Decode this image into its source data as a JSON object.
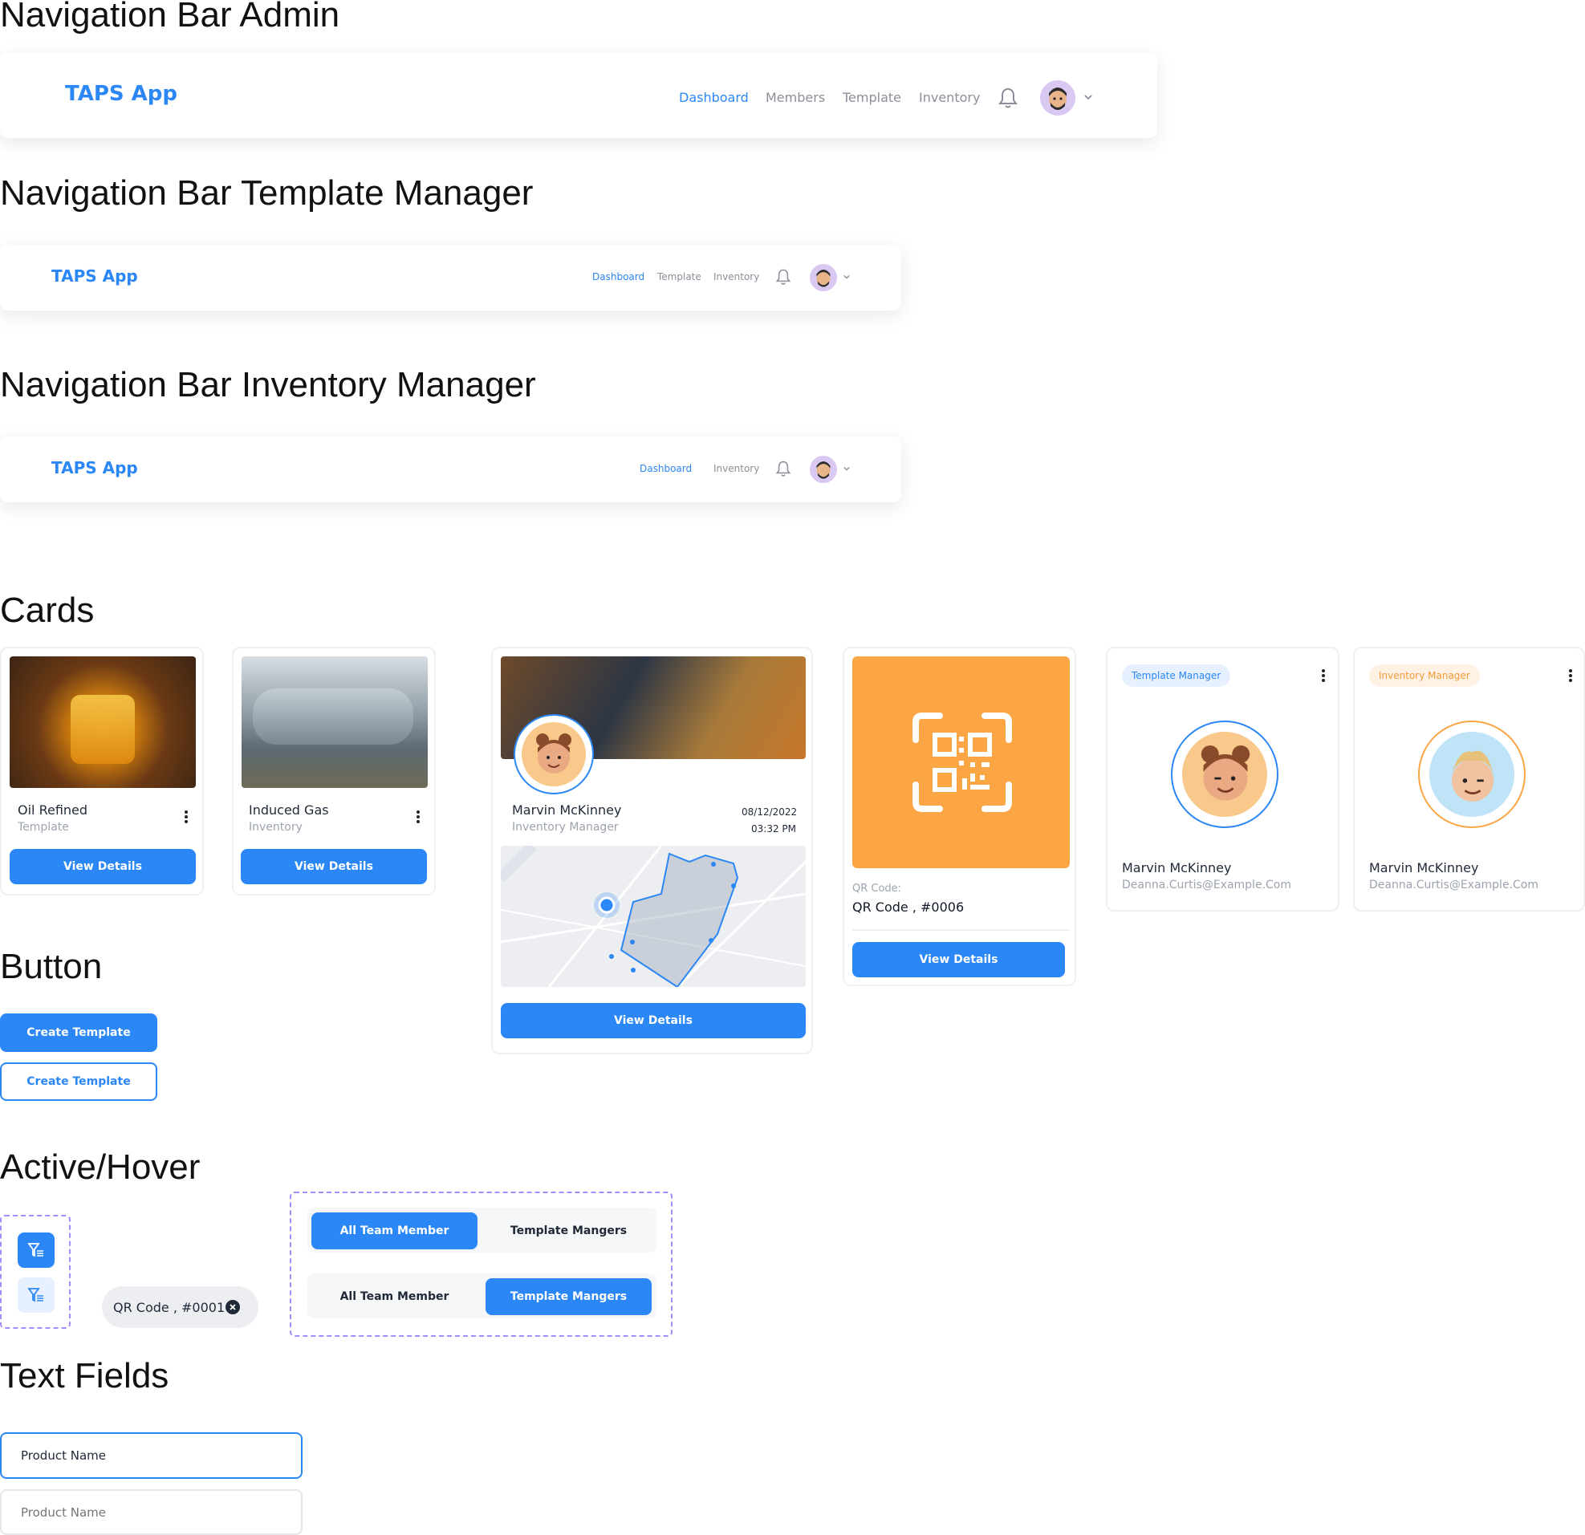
{
  "sections": {
    "nav_admin": "Navigation Bar Admin",
    "nav_template": "Navigation Bar Template Manager",
    "nav_inventory": "Navigation Bar Inventory Manager",
    "cards": "Cards",
    "button": "Button",
    "active_hover": "Active/Hover",
    "text_fields": "Text Fields"
  },
  "nav_admin": {
    "brand": "TAPS App",
    "links": [
      "Dashboard",
      "Members",
      "Template",
      "Inventory"
    ]
  },
  "nav_template": {
    "brand": "TAPS App",
    "links": [
      "Dashboard",
      "Template",
      "Inventory"
    ]
  },
  "nav_inventory": {
    "brand": "TAPS App",
    "links": [
      "Dashboard",
      "Inventory"
    ]
  },
  "cards": {
    "oil": {
      "title": "Oil Refined",
      "sub": "Template",
      "button": "View Details"
    },
    "gas": {
      "title": "Induced Gas",
      "sub": "Inventory",
      "button": "View Details"
    },
    "member": {
      "name": "Marvin McKinney",
      "role": "Inventory Manager",
      "date": "08/12/2022",
      "time": "03:32 PM",
      "button": "View Details"
    },
    "qr": {
      "label": "QR Code:",
      "value": "QR Code , #0006",
      "button": "View Details"
    },
    "template_user": {
      "chip": "Template Manager",
      "name": "Marvin McKinney",
      "email": "Deanna.Curtis@Example.Com"
    },
    "inventory_user": {
      "chip": "Inventory Manager",
      "name": "Marvin McKinney",
      "email": "Deanna.Curtis@Example.Com"
    }
  },
  "buttons": {
    "primary": "Create Template",
    "outline": "Create Template"
  },
  "active_hover": {
    "qr_chip": "QR Code , #0001",
    "tabs_row1": [
      "All Team Member",
      "Template Mangers"
    ],
    "tabs_row2": [
      "All Team Member",
      "Template Mangers"
    ]
  },
  "text_fields": {
    "field1_value": "Product Name",
    "field2_placeholder": "Product Name"
  },
  "colors": {
    "primary": "#2b87f5",
    "orange": "#fba545",
    "outline_purple": "#a78bfa"
  }
}
